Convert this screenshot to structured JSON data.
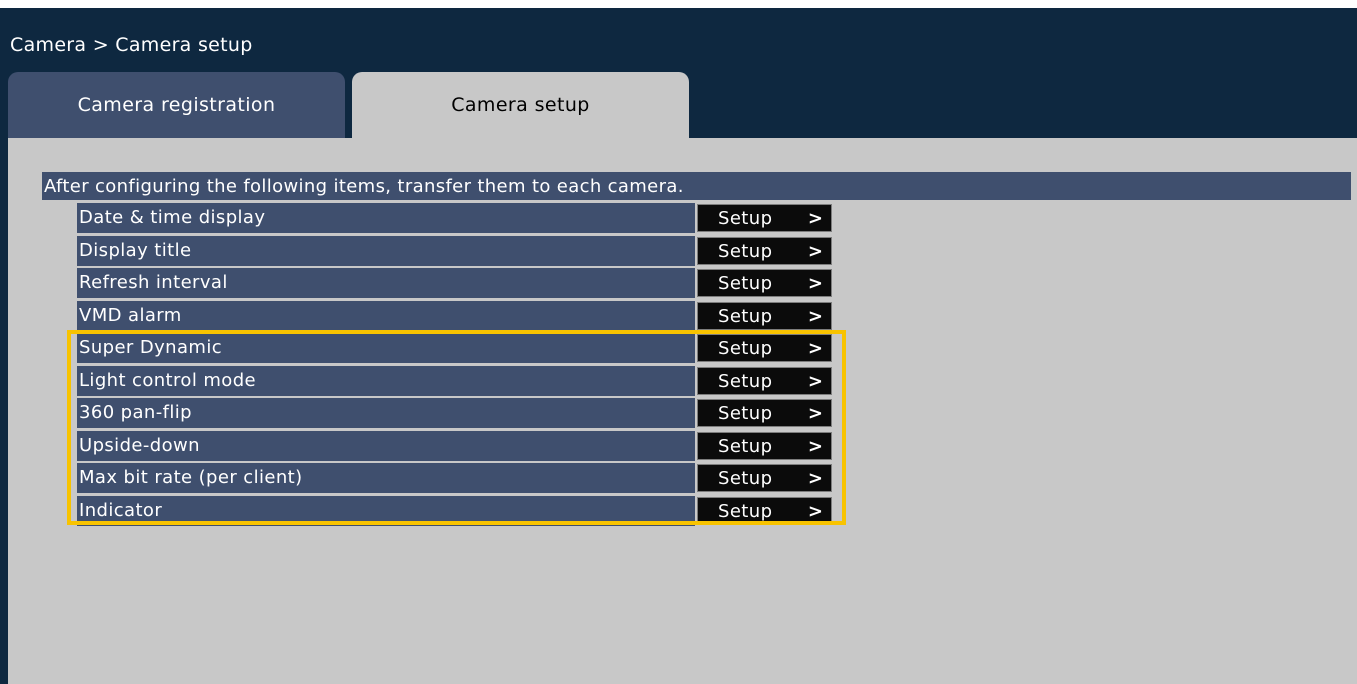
{
  "header": {
    "breadcrumb": "Camera > Camera setup"
  },
  "tabs": [
    {
      "label": "Camera registration",
      "active": false
    },
    {
      "label": "Camera setup",
      "active": true
    }
  ],
  "instruction": "After configuring the following items, transfer them to each camera.",
  "items": [
    {
      "label": "Date & time display",
      "button": "Setup",
      "chevron": ">"
    },
    {
      "label": "Display title",
      "button": "Setup",
      "chevron": ">"
    },
    {
      "label": "Refresh interval",
      "button": "Setup",
      "chevron": ">"
    },
    {
      "label": "VMD alarm",
      "button": "Setup",
      "chevron": ">"
    },
    {
      "label": "Super Dynamic",
      "button": "Setup",
      "chevron": ">"
    },
    {
      "label": "Light control mode",
      "button": "Setup",
      "chevron": ">"
    },
    {
      "label": "360 pan-flip",
      "button": "Setup",
      "chevron": ">"
    },
    {
      "label": "Upside-down",
      "button": "Setup",
      "chevron": ">"
    },
    {
      "label": "Max bit rate (per client)",
      "button": "Setup",
      "chevron": ">"
    },
    {
      "label": "Indicator",
      "button": "Setup",
      "chevron": ">"
    }
  ],
  "colors": {
    "header_bg": "#0e2840",
    "row_bg": "#3f4f6e",
    "panel_bg": "#c8c8c8",
    "button_bg": "#0b0b0b",
    "highlight": "#f8c300"
  }
}
